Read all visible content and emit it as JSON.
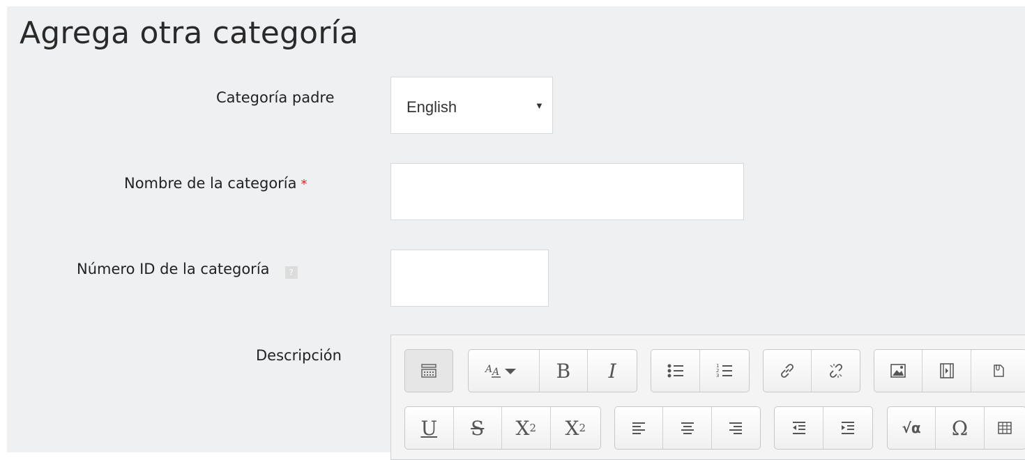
{
  "page": {
    "title": "Agrega otra categoría"
  },
  "form": {
    "parent_label": "Categoría padre",
    "parent_value": "English",
    "name_label": "Nombre de la categoría",
    "required_mark": "*",
    "id_label": "Número ID de la categoría",
    "help_mark": "?",
    "description_label": "Descripción"
  },
  "toolbar": {
    "bold": "B",
    "italic": "I",
    "underline": "U",
    "strike": "S",
    "subscript_base": "X",
    "subscript_num": "2",
    "superscript_base": "X",
    "superscript_num": "2",
    "omega": "Ω",
    "equation": "√α"
  },
  "icons": {
    "toolbar_toggle": "keyboard-icon",
    "font_style": "font-style-icon",
    "bullet_list": "bullet-list-icon",
    "numbered_list": "numbered-list-icon",
    "link": "link-icon",
    "unlink": "unlink-icon",
    "image": "image-icon",
    "media": "media-icon",
    "file": "file-icon",
    "align_left": "align-left-icon",
    "align_center": "align-center-icon",
    "align_right": "align-right-icon",
    "outdent": "outdent-icon",
    "indent": "indent-icon",
    "table": "table-icon"
  },
  "colors": {
    "required": "#d9241c",
    "panel": "#eef0f2"
  }
}
